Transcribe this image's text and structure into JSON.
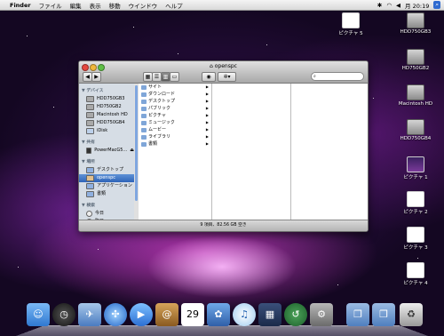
{
  "menubar": {
    "apple": "",
    "app_name": "Finder",
    "items": [
      "ファイル",
      "編集",
      "表示",
      "移動",
      "ウインドウ",
      "ヘルプ"
    ],
    "clock": "月 20:19"
  },
  "desktop_icons": [
    {
      "label": "ピクチャ 5",
      "kind": "photo"
    },
    {
      "label": "HDD750GB3",
      "kind": "hdd"
    },
    {
      "label": "HD750GB2",
      "kind": "hdd"
    },
    {
      "label": "Macintosh HD",
      "kind": "hdd"
    },
    {
      "label": "HDD750GB4",
      "kind": "hdd"
    },
    {
      "label": "ピクチャ 1",
      "kind": "photo"
    },
    {
      "label": "ピクチャ 2",
      "kind": "photo"
    },
    {
      "label": "ピクチャ 3",
      "kind": "photo"
    },
    {
      "label": "ピクチャ 4",
      "kind": "photo"
    }
  ],
  "window": {
    "title": "openspc",
    "sidebar": {
      "devices_header": "▼ デバイス",
      "devices": [
        "HDD750GB3",
        "HD750GB2",
        "Macintosh HD",
        "HDD750GB4",
        "iDisk"
      ],
      "shared_header": "▼ 共有",
      "shared": [
        "PowerMacG5..."
      ],
      "places_header": "▼ 場所",
      "places": [
        "デスクトップ",
        "openspc",
        "アプリケーション",
        "書類"
      ],
      "search_header": "▼ 検索",
      "search": [
        "今日",
        "昨日"
      ]
    },
    "files": [
      "サイト",
      "ダウンロード",
      "デスクトップ",
      "パブリック",
      "ピクチャ",
      "ミュージック",
      "ムービー",
      "ライブラリ",
      "書類"
    ],
    "status": "9 項目、82.56 GB 空き"
  },
  "dock": {
    "items": [
      "finder-icon",
      "dashboard-icon",
      "mail-icon",
      "safari-icon",
      "ichat-icon",
      "addressbook-icon",
      "ical-icon",
      "iphoto-icon",
      "itunes-icon",
      "spaces-icon",
      "timemachine-icon",
      "preferences-icon",
      "applications-folder-icon",
      "documents-folder-icon",
      "trash-icon"
    ],
    "ical_day": "29"
  }
}
